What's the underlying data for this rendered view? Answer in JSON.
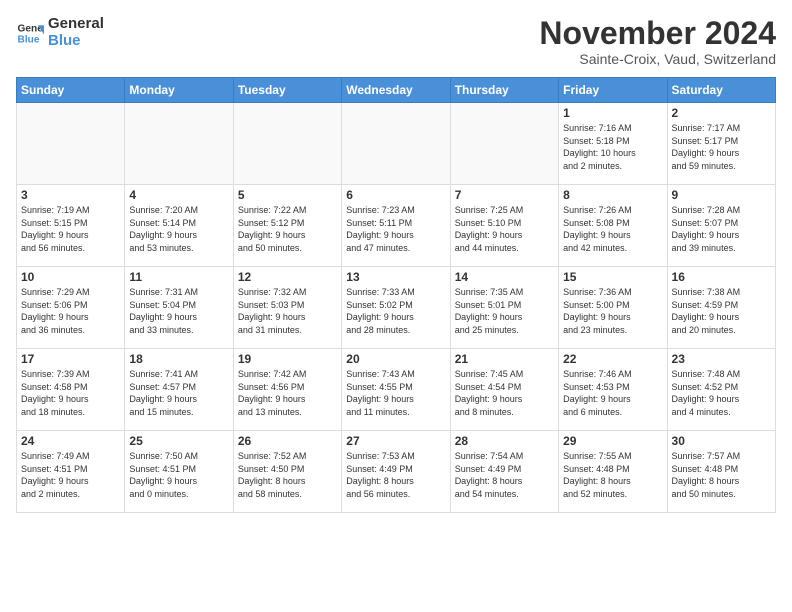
{
  "logo": {
    "line1": "General",
    "line2": "Blue"
  },
  "title": "November 2024",
  "subtitle": "Sainte-Croix, Vaud, Switzerland",
  "days_header": [
    "Sunday",
    "Monday",
    "Tuesday",
    "Wednesday",
    "Thursday",
    "Friday",
    "Saturday"
  ],
  "weeks": [
    [
      {
        "day": "",
        "info": ""
      },
      {
        "day": "",
        "info": ""
      },
      {
        "day": "",
        "info": ""
      },
      {
        "day": "",
        "info": ""
      },
      {
        "day": "",
        "info": ""
      },
      {
        "day": "1",
        "info": "Sunrise: 7:16 AM\nSunset: 5:18 PM\nDaylight: 10 hours\nand 2 minutes."
      },
      {
        "day": "2",
        "info": "Sunrise: 7:17 AM\nSunset: 5:17 PM\nDaylight: 9 hours\nand 59 minutes."
      }
    ],
    [
      {
        "day": "3",
        "info": "Sunrise: 7:19 AM\nSunset: 5:15 PM\nDaylight: 9 hours\nand 56 minutes."
      },
      {
        "day": "4",
        "info": "Sunrise: 7:20 AM\nSunset: 5:14 PM\nDaylight: 9 hours\nand 53 minutes."
      },
      {
        "day": "5",
        "info": "Sunrise: 7:22 AM\nSunset: 5:12 PM\nDaylight: 9 hours\nand 50 minutes."
      },
      {
        "day": "6",
        "info": "Sunrise: 7:23 AM\nSunset: 5:11 PM\nDaylight: 9 hours\nand 47 minutes."
      },
      {
        "day": "7",
        "info": "Sunrise: 7:25 AM\nSunset: 5:10 PM\nDaylight: 9 hours\nand 44 minutes."
      },
      {
        "day": "8",
        "info": "Sunrise: 7:26 AM\nSunset: 5:08 PM\nDaylight: 9 hours\nand 42 minutes."
      },
      {
        "day": "9",
        "info": "Sunrise: 7:28 AM\nSunset: 5:07 PM\nDaylight: 9 hours\nand 39 minutes."
      }
    ],
    [
      {
        "day": "10",
        "info": "Sunrise: 7:29 AM\nSunset: 5:06 PM\nDaylight: 9 hours\nand 36 minutes."
      },
      {
        "day": "11",
        "info": "Sunrise: 7:31 AM\nSunset: 5:04 PM\nDaylight: 9 hours\nand 33 minutes."
      },
      {
        "day": "12",
        "info": "Sunrise: 7:32 AM\nSunset: 5:03 PM\nDaylight: 9 hours\nand 31 minutes."
      },
      {
        "day": "13",
        "info": "Sunrise: 7:33 AM\nSunset: 5:02 PM\nDaylight: 9 hours\nand 28 minutes."
      },
      {
        "day": "14",
        "info": "Sunrise: 7:35 AM\nSunset: 5:01 PM\nDaylight: 9 hours\nand 25 minutes."
      },
      {
        "day": "15",
        "info": "Sunrise: 7:36 AM\nSunset: 5:00 PM\nDaylight: 9 hours\nand 23 minutes."
      },
      {
        "day": "16",
        "info": "Sunrise: 7:38 AM\nSunset: 4:59 PM\nDaylight: 9 hours\nand 20 minutes."
      }
    ],
    [
      {
        "day": "17",
        "info": "Sunrise: 7:39 AM\nSunset: 4:58 PM\nDaylight: 9 hours\nand 18 minutes."
      },
      {
        "day": "18",
        "info": "Sunrise: 7:41 AM\nSunset: 4:57 PM\nDaylight: 9 hours\nand 15 minutes."
      },
      {
        "day": "19",
        "info": "Sunrise: 7:42 AM\nSunset: 4:56 PM\nDaylight: 9 hours\nand 13 minutes."
      },
      {
        "day": "20",
        "info": "Sunrise: 7:43 AM\nSunset: 4:55 PM\nDaylight: 9 hours\nand 11 minutes."
      },
      {
        "day": "21",
        "info": "Sunrise: 7:45 AM\nSunset: 4:54 PM\nDaylight: 9 hours\nand 8 minutes."
      },
      {
        "day": "22",
        "info": "Sunrise: 7:46 AM\nSunset: 4:53 PM\nDaylight: 9 hours\nand 6 minutes."
      },
      {
        "day": "23",
        "info": "Sunrise: 7:48 AM\nSunset: 4:52 PM\nDaylight: 9 hours\nand 4 minutes."
      }
    ],
    [
      {
        "day": "24",
        "info": "Sunrise: 7:49 AM\nSunset: 4:51 PM\nDaylight: 9 hours\nand 2 minutes."
      },
      {
        "day": "25",
        "info": "Sunrise: 7:50 AM\nSunset: 4:51 PM\nDaylight: 9 hours\nand 0 minutes."
      },
      {
        "day": "26",
        "info": "Sunrise: 7:52 AM\nSunset: 4:50 PM\nDaylight: 8 hours\nand 58 minutes."
      },
      {
        "day": "27",
        "info": "Sunrise: 7:53 AM\nSunset: 4:49 PM\nDaylight: 8 hours\nand 56 minutes."
      },
      {
        "day": "28",
        "info": "Sunrise: 7:54 AM\nSunset: 4:49 PM\nDaylight: 8 hours\nand 54 minutes."
      },
      {
        "day": "29",
        "info": "Sunrise: 7:55 AM\nSunset: 4:48 PM\nDaylight: 8 hours\nand 52 minutes."
      },
      {
        "day": "30",
        "info": "Sunrise: 7:57 AM\nSunset: 4:48 PM\nDaylight: 8 hours\nand 50 minutes."
      }
    ]
  ]
}
